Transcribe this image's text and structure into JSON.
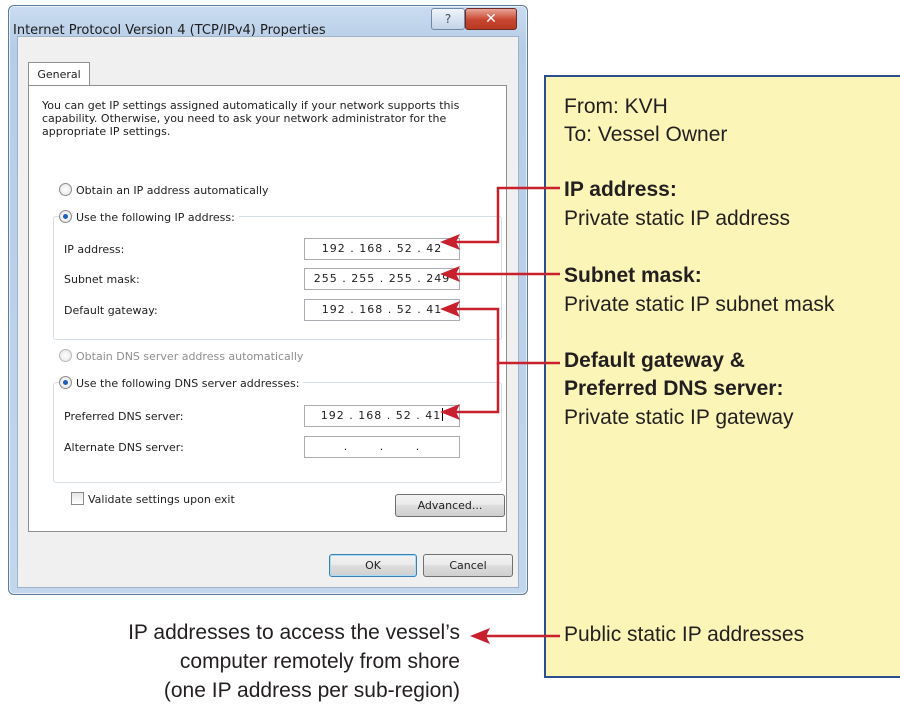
{
  "dialog": {
    "title": "Internet Protocol Version 4 (TCP/IPv4) Properties",
    "help_glyph": "?",
    "close_glyph": "✕",
    "tab_label": "General",
    "description": "You can get IP settings assigned automatically if your network supports this capability. Otherwise, you need to ask your network administrator for the appropriate IP settings.",
    "ip_auto_label": "Obtain an IP address automatically",
    "ip_manual_label": "Use the following IP address:",
    "ip_address_label": "IP address:",
    "ip_address_value": "192 . 168 . 52 . 42",
    "subnet_mask_label": "Subnet mask:",
    "subnet_mask_value": "255 . 255 . 255 . 249",
    "default_gateway_label": "Default gateway:",
    "default_gateway_value": "192 . 168 . 52 . 41",
    "dns_auto_label": "Obtain DNS server address automatically",
    "dns_manual_label": "Use the following DNS server addresses:",
    "preferred_dns_label": "Preferred DNS server:",
    "preferred_dns_value": "192 . 168 . 52 . 41",
    "alternate_dns_label": "Alternate DNS server:",
    "alternate_dns_value": ".       .       .",
    "validate_label": "Validate settings upon exit",
    "advanced_label": "Advanced...",
    "ok_label": "OK",
    "cancel_label": "Cancel"
  },
  "note": {
    "from": "From: KVH",
    "to": "To: Vessel Owner",
    "ip_heading": "IP address:",
    "ip_desc": "Private static IP address",
    "subnet_heading": "Subnet mask:",
    "subnet_desc": "Private static IP subnet mask",
    "gateway_heading_1": "Default gateway &",
    "gateway_heading_2": "Preferred DNS server:",
    "gateway_desc": "Private static IP gateway",
    "public_label": "Public static IP addresses"
  },
  "caption": {
    "line1": "IP addresses to access the vessel’s",
    "line2": "computer remotely from shore",
    "line3": "(one IP address per sub-region)"
  },
  "colors": {
    "arrow": "#c8202d",
    "note_bg": "#fbf6b8",
    "note_border": "#2b4e8c"
  }
}
